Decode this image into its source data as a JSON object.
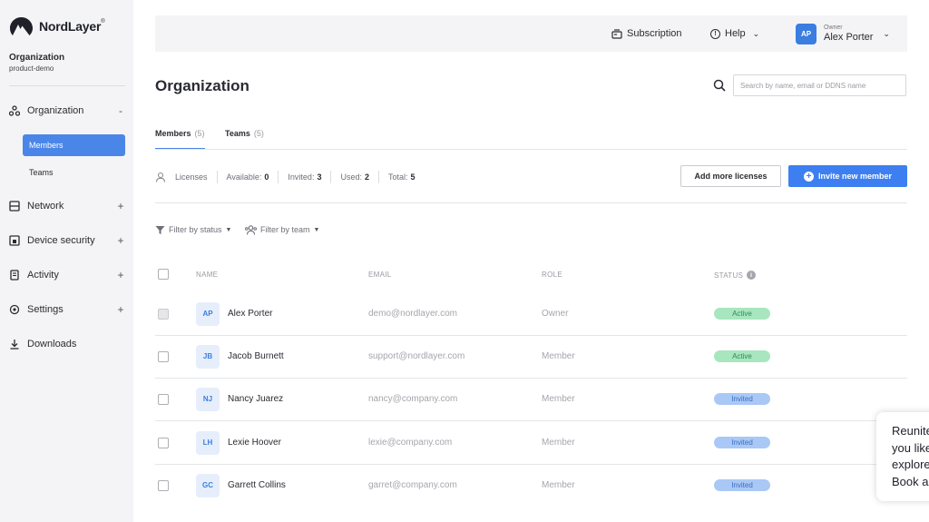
{
  "brand": {
    "name": "NordLayer",
    "tm": "®"
  },
  "org": {
    "title": "Organization",
    "subtitle": "product-demo"
  },
  "sidebar": {
    "items": [
      {
        "label": "Organization",
        "toggle": "-",
        "icon": "organization-icon"
      },
      {
        "label": "Network",
        "toggle": "+",
        "icon": "network-icon"
      },
      {
        "label": "Device security",
        "toggle": "+",
        "icon": "device-security-icon"
      },
      {
        "label": "Activity",
        "toggle": "+",
        "icon": "activity-icon"
      },
      {
        "label": "Settings",
        "toggle": "+",
        "icon": "settings-icon"
      },
      {
        "label": "Downloads",
        "toggle": "",
        "icon": "download-icon"
      }
    ],
    "subitems": [
      {
        "label": "Members"
      },
      {
        "label": "Teams"
      }
    ]
  },
  "topbar": {
    "subscription": "Subscription",
    "help": "Help",
    "user": {
      "initials": "AP",
      "role": "Owner",
      "name": "Alex Porter"
    }
  },
  "page": {
    "title": "Organization",
    "search_placeholder": "Search by name, email or DDNS name"
  },
  "tabs": [
    {
      "label": "Members",
      "count": "(5)"
    },
    {
      "label": "Teams",
      "count": "(5)"
    }
  ],
  "licenses": {
    "label": "Licenses",
    "available_label": "Available:",
    "available": "0",
    "invited_label": "Invited:",
    "invited": "3",
    "used_label": "Used:",
    "used": "2",
    "total_label": "Total:",
    "total": "5",
    "add_button": "Add more licenses",
    "invite_button": "Invite new member"
  },
  "filters": {
    "status": "Filter by status",
    "team": "Filter by team"
  },
  "table": {
    "headers": {
      "name": "NAME",
      "email": "EMAIL",
      "role": "ROLE",
      "status": "STATUS"
    },
    "rows": [
      {
        "initials": "AP",
        "name": "Alex Porter",
        "email": "demo@nordlayer.com",
        "role": "Owner",
        "status": "Active"
      },
      {
        "initials": "JB",
        "name": "Jacob Burnett",
        "email": "support@nordlayer.com",
        "role": "Member",
        "status": "Active"
      },
      {
        "initials": "NJ",
        "name": "Nancy Juarez",
        "email": "nancy@company.com",
        "role": "Member",
        "status": "Invited"
      },
      {
        "initials": "LH",
        "name": "Lexie Hoover",
        "email": "lexie@company.com",
        "role": "Member",
        "status": "Invited"
      },
      {
        "initials": "GC",
        "name": "Garrett Collins",
        "email": "garret@company.com",
        "role": "Member",
        "status": "Invited"
      }
    ]
  },
  "chat_popup": {
    "lines": [
      "Reunite",
      "you like",
      "explore",
      "Book a"
    ]
  },
  "colors": {
    "accent": "#3d7ff0",
    "active_pill": "#a8e6bf",
    "invited_pill": "#a9c8f5"
  }
}
